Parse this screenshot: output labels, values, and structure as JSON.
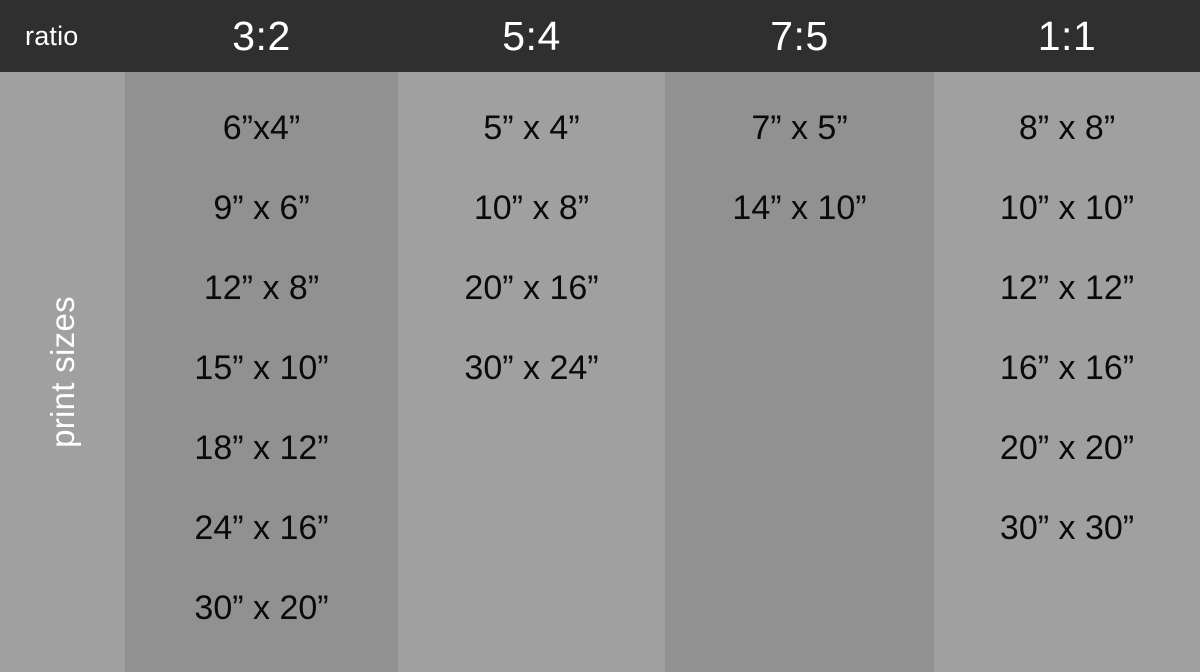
{
  "header": {
    "row_label_header": "ratio",
    "columns": [
      {
        "id": "col-3-2",
        "label": "3:2"
      },
      {
        "id": "col-5-4",
        "label": "5:4"
      },
      {
        "id": "col-7-5",
        "label": "7:5"
      },
      {
        "id": "col-1-1",
        "label": "1:1"
      }
    ]
  },
  "row_group_label": "print sizes",
  "colors": {
    "header_bg": "#2f2f2f",
    "header_text": "#ffffff",
    "column_bg_dark": "#919191",
    "column_bg_light": "#a0a0a0",
    "label_column_bg": "#a0a0a0",
    "cell_text": "#0a0a0a",
    "label_text": "#ffffff"
  },
  "chart_data": {
    "type": "table",
    "title": "print sizes",
    "column_header_label": "ratio",
    "columns": [
      "3:2",
      "5:4",
      "7:5",
      "1:1"
    ],
    "row_group_label": "print sizes",
    "cells": {
      "3:2": [
        "6”x4”",
        "9” x 6”",
        "12” x 8”",
        "15” x 10”",
        "18” x 12”",
        "24” x 16”",
        "30” x 20”"
      ],
      "5:4": [
        "5” x 4”",
        "10” x 8”",
        "20” x 16”",
        "30” x 24”"
      ],
      "7:5": [
        "7” x 5”",
        "14” x 10”"
      ],
      "1:1": [
        "8” x 8”",
        "10” x 10”",
        "12” x 12”",
        "16” x 16”",
        "20” x 20”",
        "30” x 30”"
      ]
    }
  },
  "columns": [
    {
      "ratio": "3:2",
      "sizes": [
        "6”x4”",
        "9” x 6”",
        "12” x 8”",
        "15” x 10”",
        "18” x 12”",
        "24” x 16”",
        "30” x 20”"
      ]
    },
    {
      "ratio": "5:4",
      "sizes": [
        "5” x 4”",
        "10” x 8”",
        "20” x 16”",
        "30” x 24”"
      ]
    },
    {
      "ratio": "7:5",
      "sizes": [
        "7” x 5”",
        "14” x 10”"
      ]
    },
    {
      "ratio": "1:1",
      "sizes": [
        "8” x 8”",
        "10” x 10”",
        "12” x 12”",
        "16” x 16”",
        "20” x 20”",
        "30” x 30”"
      ]
    }
  ]
}
